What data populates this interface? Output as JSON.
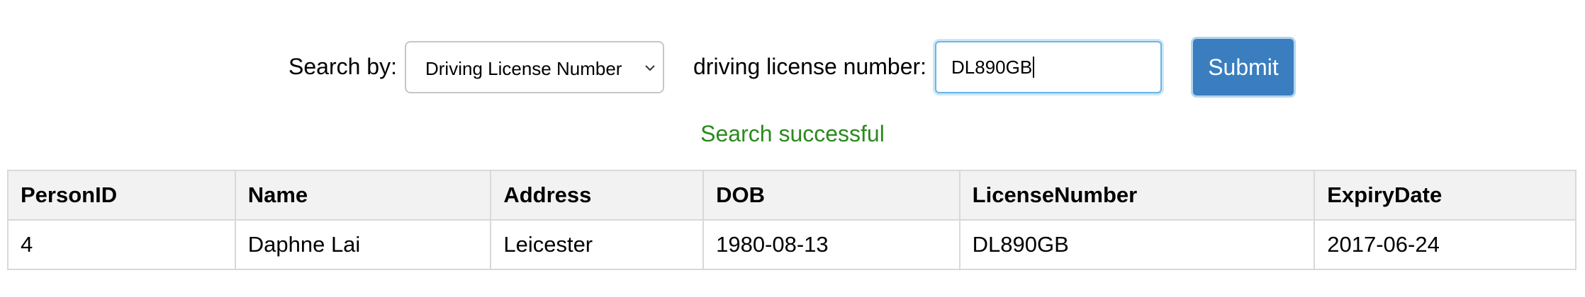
{
  "search": {
    "label": "Search by:",
    "selected_option": "Driving License Number",
    "field_label": "driving license number:",
    "input_value": "DL890GB",
    "submit_label": "Submit"
  },
  "status": {
    "message": "Search successful",
    "color": "#2a8a1e"
  },
  "colors": {
    "submit_bg": "#3a7ec0",
    "input_focus_border": "#6ab4e4"
  },
  "table": {
    "columns": [
      "PersonID",
      "Name",
      "Address",
      "DOB",
      "LicenseNumber",
      "ExpiryDate"
    ],
    "rows": [
      [
        "4",
        "Daphne Lai",
        "Leicester",
        "1980-08-13",
        "DL890GB",
        "2017-06-24"
      ]
    ]
  }
}
